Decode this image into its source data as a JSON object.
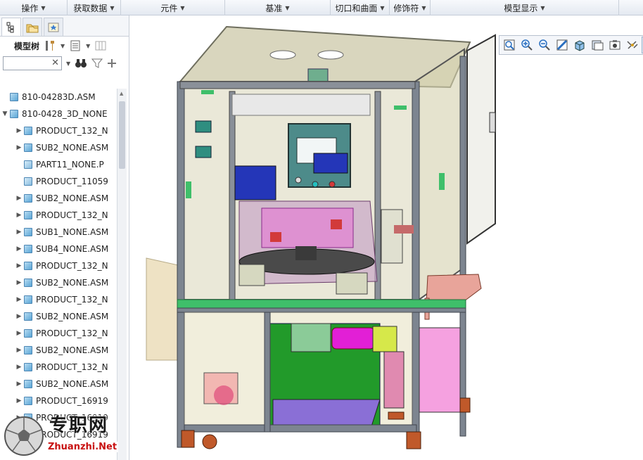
{
  "menubar": {
    "groups": [
      {
        "label": "操作"
      },
      {
        "label": "获取数据"
      },
      {
        "label": "元件"
      },
      {
        "label": "基准"
      },
      {
        "label": "切口和曲面"
      },
      {
        "label": "修饰符"
      },
      {
        "label": "模型显示"
      }
    ]
  },
  "left_panel": {
    "tabs": [
      "model-tree-tab",
      "folder-browser-tab",
      "favorites-tab"
    ],
    "title": "模型树",
    "search": {
      "value": "",
      "placeholder": ""
    },
    "tree": [
      {
        "label": "810-04283D.ASM",
        "level": 0,
        "expander": "",
        "kind": "asm"
      },
      {
        "label": "810-0428_3D_NONE",
        "level": 0,
        "expander": "▼",
        "kind": "asm"
      },
      {
        "label": "PRODUCT_132_N",
        "level": 1,
        "expander": "▶",
        "kind": "asm"
      },
      {
        "label": "SUB2_NONE.ASM",
        "level": 1,
        "expander": "▶",
        "kind": "asm"
      },
      {
        "label": "PART11_NONE.P",
        "level": 1,
        "expander": "",
        "kind": "part"
      },
      {
        "label": "PRODUCT_11059",
        "level": 1,
        "expander": "",
        "kind": "part"
      },
      {
        "label": "SUB2_NONE.ASM",
        "level": 1,
        "expander": "▶",
        "kind": "asm"
      },
      {
        "label": "PRODUCT_132_N",
        "level": 1,
        "expander": "▶",
        "kind": "asm"
      },
      {
        "label": "SUB1_NONE.ASM",
        "level": 1,
        "expander": "▶",
        "kind": "asm"
      },
      {
        "label": "SUB4_NONE.ASM",
        "level": 1,
        "expander": "▶",
        "kind": "asm"
      },
      {
        "label": "PRODUCT_132_N",
        "level": 1,
        "expander": "▶",
        "kind": "asm"
      },
      {
        "label": "SUB2_NONE.ASM",
        "level": 1,
        "expander": "▶",
        "kind": "asm"
      },
      {
        "label": "PRODUCT_132_N",
        "level": 1,
        "expander": "▶",
        "kind": "asm"
      },
      {
        "label": "SUB2_NONE.ASM",
        "level": 1,
        "expander": "▶",
        "kind": "asm"
      },
      {
        "label": "PRODUCT_132_N",
        "level": 1,
        "expander": "▶",
        "kind": "asm"
      },
      {
        "label": "SUB2_NONE.ASM",
        "level": 1,
        "expander": "▶",
        "kind": "asm"
      },
      {
        "label": "PRODUCT_132_N",
        "level": 1,
        "expander": "▶",
        "kind": "asm"
      },
      {
        "label": "SUB2_NONE.ASM",
        "level": 1,
        "expander": "▶",
        "kind": "asm"
      },
      {
        "label": "PRODUCT_16919",
        "level": 1,
        "expander": "▶",
        "kind": "asm"
      },
      {
        "label": "PRODUCT_16919",
        "level": 1,
        "expander": "▶",
        "kind": "asm"
      },
      {
        "label": "PRODUCT_16919",
        "level": 1,
        "expander": "▶",
        "kind": "asm"
      }
    ]
  },
  "view_toolbar": {
    "buttons": [
      "refit-icon",
      "zoom-in-icon",
      "zoom-out-icon",
      "repaint-icon",
      "display-style-icon",
      "saved-views-icon",
      "view-manager-icon",
      "datum-display-icon",
      "annotation-display-icon",
      "spin-center-icon"
    ]
  },
  "watermark": {
    "cn": "专职网",
    "en": "Zhuanzhi.Net"
  },
  "colors": {
    "frame": "#7d8590",
    "frame_dark": "#4a5058",
    "glass": "#d9d6b8",
    "green_rail": "#3fbf6a",
    "accent_pink": "#e86fd6",
    "accent_blue": "#2436b8"
  }
}
